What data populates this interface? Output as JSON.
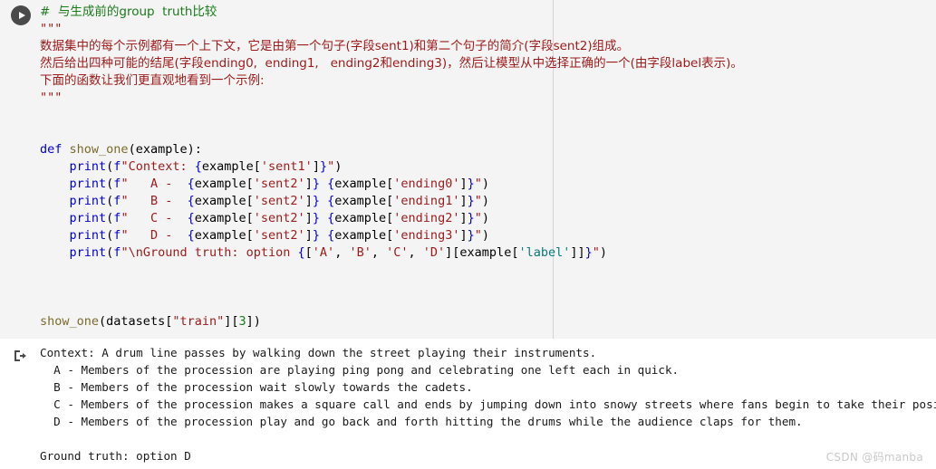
{
  "notebook": {
    "run_button_label": "run-cell",
    "output_prompt": "output-marker",
    "ruler_column": "88"
  },
  "code": {
    "lines": [
      {
        "id": "l1",
        "tokens": [
          {
            "t": "comment",
            "v": "#  与生成前的group  truth比较"
          }
        ]
      },
      {
        "id": "l2",
        "tokens": [
          {
            "t": "string",
            "v": "\"\"\""
          }
        ]
      },
      {
        "id": "l3",
        "tokens": [
          {
            "t": "string",
            "v": "数据集中的每个示例都有一个上下文，它是由第一个句子(字段sent1)和第二个句子的简介(字段sent2)组成。"
          }
        ]
      },
      {
        "id": "l4",
        "tokens": [
          {
            "t": "string",
            "v": "然后给出四种可能的结尾(字段ending0,  ending1,   ending2和ending3)，然后让模型从中选择正确的一个(由字段label表示)。"
          }
        ]
      },
      {
        "id": "l5",
        "tokens": [
          {
            "t": "string",
            "v": "下面的函数让我们更直观地看到一个示例:"
          }
        ]
      },
      {
        "id": "l6",
        "tokens": [
          {
            "t": "string",
            "v": "\"\"\""
          }
        ]
      },
      {
        "id": "l7",
        "tokens": []
      },
      {
        "id": "l8",
        "tokens": []
      },
      {
        "id": "l9",
        "tokens": [
          {
            "t": "kw",
            "v": "def"
          },
          {
            "t": "plain",
            "v": " "
          },
          {
            "t": "fn",
            "v": "show_one"
          },
          {
            "t": "punct",
            "v": "("
          },
          {
            "t": "var",
            "v": "example"
          },
          {
            "t": "punct",
            "v": "):"
          }
        ]
      },
      {
        "id": "l10",
        "tokens": [
          {
            "t": "plain",
            "v": "    "
          },
          {
            "t": "blue",
            "v": "print"
          },
          {
            "t": "punct",
            "v": "("
          },
          {
            "t": "blue",
            "v": "f"
          },
          {
            "t": "string",
            "v": "\"Context: "
          },
          {
            "t": "brace",
            "v": "{"
          },
          {
            "t": "var",
            "v": "example"
          },
          {
            "t": "punct",
            "v": "["
          },
          {
            "t": "key",
            "v": "'sent1'"
          },
          {
            "t": "punct",
            "v": "]"
          },
          {
            "t": "brace",
            "v": "}"
          },
          {
            "t": "string",
            "v": "\""
          },
          {
            "t": "punct",
            "v": ")"
          }
        ]
      },
      {
        "id": "l11",
        "tokens": [
          {
            "t": "plain",
            "v": "    "
          },
          {
            "t": "blue",
            "v": "print"
          },
          {
            "t": "punct",
            "v": "("
          },
          {
            "t": "blue",
            "v": "f"
          },
          {
            "t": "string",
            "v": "\"   A -  "
          },
          {
            "t": "brace",
            "v": "{"
          },
          {
            "t": "var",
            "v": "example"
          },
          {
            "t": "punct",
            "v": "["
          },
          {
            "t": "key",
            "v": "'sent2'"
          },
          {
            "t": "punct",
            "v": "]"
          },
          {
            "t": "brace",
            "v": "}"
          },
          {
            "t": "string",
            "v": " "
          },
          {
            "t": "brace",
            "v": "{"
          },
          {
            "t": "var",
            "v": "example"
          },
          {
            "t": "punct",
            "v": "["
          },
          {
            "t": "key",
            "v": "'ending0'"
          },
          {
            "t": "punct",
            "v": "]"
          },
          {
            "t": "brace",
            "v": "}"
          },
          {
            "t": "string",
            "v": "\""
          },
          {
            "t": "punct",
            "v": ")"
          }
        ]
      },
      {
        "id": "l12",
        "tokens": [
          {
            "t": "plain",
            "v": "    "
          },
          {
            "t": "blue",
            "v": "print"
          },
          {
            "t": "punct",
            "v": "("
          },
          {
            "t": "blue",
            "v": "f"
          },
          {
            "t": "string",
            "v": "\"   B -  "
          },
          {
            "t": "brace",
            "v": "{"
          },
          {
            "t": "var",
            "v": "example"
          },
          {
            "t": "punct",
            "v": "["
          },
          {
            "t": "key",
            "v": "'sent2'"
          },
          {
            "t": "punct",
            "v": "]"
          },
          {
            "t": "brace",
            "v": "}"
          },
          {
            "t": "string",
            "v": " "
          },
          {
            "t": "brace",
            "v": "{"
          },
          {
            "t": "var",
            "v": "example"
          },
          {
            "t": "punct",
            "v": "["
          },
          {
            "t": "key",
            "v": "'ending1'"
          },
          {
            "t": "punct",
            "v": "]"
          },
          {
            "t": "brace",
            "v": "}"
          },
          {
            "t": "string",
            "v": "\""
          },
          {
            "t": "punct",
            "v": ")"
          }
        ]
      },
      {
        "id": "l13",
        "tokens": [
          {
            "t": "plain",
            "v": "    "
          },
          {
            "t": "blue",
            "v": "print"
          },
          {
            "t": "punct",
            "v": "("
          },
          {
            "t": "blue",
            "v": "f"
          },
          {
            "t": "string",
            "v": "\"   C -  "
          },
          {
            "t": "brace",
            "v": "{"
          },
          {
            "t": "var",
            "v": "example"
          },
          {
            "t": "punct",
            "v": "["
          },
          {
            "t": "key",
            "v": "'sent2'"
          },
          {
            "t": "punct",
            "v": "]"
          },
          {
            "t": "brace",
            "v": "}"
          },
          {
            "t": "string",
            "v": " "
          },
          {
            "t": "brace",
            "v": "{"
          },
          {
            "t": "var",
            "v": "example"
          },
          {
            "t": "punct",
            "v": "["
          },
          {
            "t": "key",
            "v": "'ending2'"
          },
          {
            "t": "punct",
            "v": "]"
          },
          {
            "t": "brace",
            "v": "}"
          },
          {
            "t": "string",
            "v": "\""
          },
          {
            "t": "punct",
            "v": ")"
          }
        ]
      },
      {
        "id": "l14",
        "tokens": [
          {
            "t": "plain",
            "v": "    "
          },
          {
            "t": "blue",
            "v": "print"
          },
          {
            "t": "punct",
            "v": "("
          },
          {
            "t": "blue",
            "v": "f"
          },
          {
            "t": "string",
            "v": "\"   D -  "
          },
          {
            "t": "brace",
            "v": "{"
          },
          {
            "t": "var",
            "v": "example"
          },
          {
            "t": "punct",
            "v": "["
          },
          {
            "t": "key",
            "v": "'sent2'"
          },
          {
            "t": "punct",
            "v": "]"
          },
          {
            "t": "brace",
            "v": "}"
          },
          {
            "t": "string",
            "v": " "
          },
          {
            "t": "brace",
            "v": "{"
          },
          {
            "t": "var",
            "v": "example"
          },
          {
            "t": "punct",
            "v": "["
          },
          {
            "t": "key",
            "v": "'ending3'"
          },
          {
            "t": "punct",
            "v": "]"
          },
          {
            "t": "brace",
            "v": "}"
          },
          {
            "t": "string",
            "v": "\""
          },
          {
            "t": "punct",
            "v": ")"
          }
        ]
      },
      {
        "id": "l15",
        "tokens": [
          {
            "t": "plain",
            "v": "    "
          },
          {
            "t": "blue",
            "v": "print"
          },
          {
            "t": "punct",
            "v": "("
          },
          {
            "t": "blue",
            "v": "f"
          },
          {
            "t": "string",
            "v": "\"\\nGround truth: option "
          },
          {
            "t": "brace",
            "v": "{"
          },
          {
            "t": "punct",
            "v": "["
          },
          {
            "t": "key",
            "v": "'A'"
          },
          {
            "t": "punct",
            "v": ", "
          },
          {
            "t": "key",
            "v": "'B'"
          },
          {
            "t": "punct",
            "v": ", "
          },
          {
            "t": "key",
            "v": "'C'"
          },
          {
            "t": "punct",
            "v": ", "
          },
          {
            "t": "key",
            "v": "'D'"
          },
          {
            "t": "punct",
            "v": "]["
          },
          {
            "t": "var",
            "v": "example"
          },
          {
            "t": "punct",
            "v": "["
          },
          {
            "t": "teal",
            "v": "'label'"
          },
          {
            "t": "punct",
            "v": "]]"
          },
          {
            "t": "brace",
            "v": "}"
          },
          {
            "t": "string",
            "v": "\""
          },
          {
            "t": "punct",
            "v": ")"
          }
        ]
      },
      {
        "id": "l16",
        "tokens": []
      },
      {
        "id": "l17",
        "tokens": []
      },
      {
        "id": "l18",
        "tokens": []
      },
      {
        "id": "l19",
        "tokens": [
          {
            "t": "fn",
            "v": "show_one"
          },
          {
            "t": "punct",
            "v": "("
          },
          {
            "t": "var",
            "v": "datasets"
          },
          {
            "t": "punct",
            "v": "["
          },
          {
            "t": "string",
            "v": "\"train\""
          },
          {
            "t": "punct",
            "v": "]["
          },
          {
            "t": "num",
            "v": "3"
          },
          {
            "t": "punct",
            "v": "])"
          }
        ]
      }
    ]
  },
  "output": {
    "lines": [
      "Context: A drum line passes by walking down the street playing their instruments.",
      "  A - Members of the procession are playing ping pong and celebrating one left each in quick.",
      "  B - Members of the procession wait slowly towards the cadets.",
      "  C - Members of the procession makes a square call and ends by jumping down into snowy streets where fans begin to take their positions.",
      "  D - Members of the procession play and go back and forth hitting the drums while the audience claps for them.",
      "",
      "Ground truth: option D"
    ]
  },
  "watermark": {
    "text": "CSDN @码manba"
  },
  "colors": {
    "cell_background": "#f4f4f4",
    "output_background": "#ffffff",
    "comment": "#1a7a1a",
    "string": "#9c1a1a",
    "keyword": "#0000cc",
    "function": "#7a6a2a",
    "ruler": "#d3d3d3",
    "run_button": "#4a4a4a",
    "watermark": "#c9c9c9"
  }
}
